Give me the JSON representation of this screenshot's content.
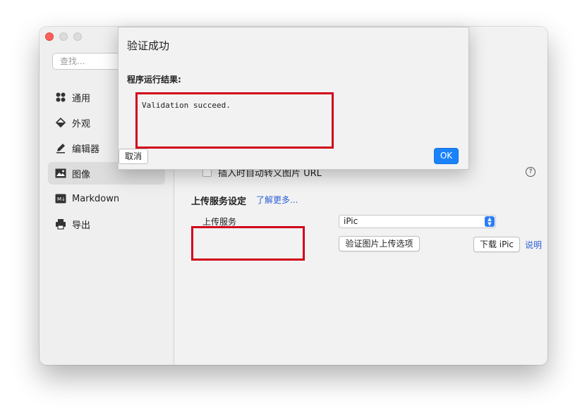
{
  "window": {
    "search_placeholder": "查找...",
    "sidebar": {
      "items": [
        {
          "label": "通用",
          "icon": "grid-icon"
        },
        {
          "label": "外观",
          "icon": "paint-bucket-icon"
        },
        {
          "label": "编辑器",
          "icon": "pencil-icon"
        },
        {
          "label": "图像",
          "icon": "image-icon",
          "active": true
        },
        {
          "label": "Markdown",
          "icon": "markdown-icon"
        },
        {
          "label": "导出",
          "icon": "printer-icon"
        }
      ]
    },
    "content": {
      "url_option_label": "插入时自动转义图片 URL",
      "help_glyph": "?",
      "upload_section_title": "上传服务设定",
      "learn_more": "了解更多...",
      "upload_service_label": "上传服务",
      "upload_service_value": "iPic",
      "validate_button": "验证图片上传选项",
      "download_button": "下载 iPic",
      "explain_link": "说明"
    }
  },
  "dialog": {
    "title": "验证成功",
    "result_label": "程序运行结果:",
    "result_text": "Validation succeed.",
    "cancel_button": "取消",
    "ok_button": "OK"
  },
  "colors": {
    "accent": "#1a82fb",
    "link": "#2b5fd9",
    "highlight_box": "#d0021b"
  }
}
